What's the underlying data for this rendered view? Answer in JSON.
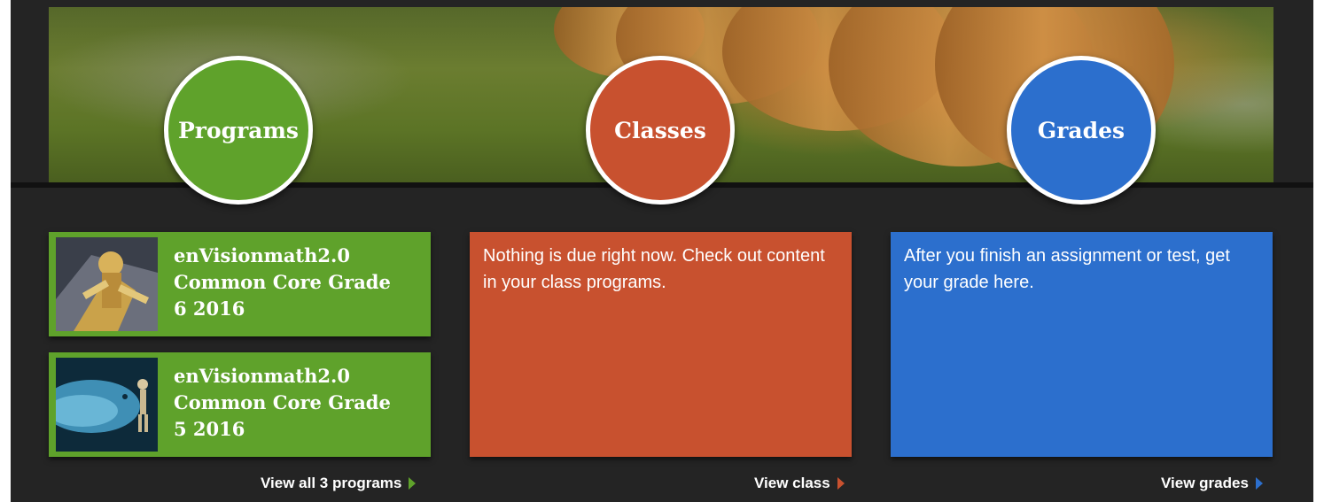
{
  "hero": {
    "circles": [
      {
        "label": "Programs",
        "color": "#5fa22b"
      },
      {
        "label": "Classes",
        "color": "#c8512f"
      },
      {
        "label": "Grades",
        "color": "#2c6fcd"
      }
    ]
  },
  "programs": {
    "items": [
      {
        "title": "enVisionmath2.0 Common Core Grade 6 2016",
        "thumb_icon": "robot-thumbnail-icon"
      },
      {
        "title": "enVisionmath2.0 Common Core Grade 5 2016",
        "thumb_icon": "whale-diver-thumbnail-icon"
      }
    ],
    "link_label": "View all 3 programs"
  },
  "classes": {
    "message": "Nothing is due right now. Check out content in your class programs.",
    "link_label": "View class"
  },
  "grades": {
    "message": "After you finish an assignment or test, get your grade here.",
    "link_label": "View grades"
  },
  "colors": {
    "programs": "#5fa22b",
    "classes": "#c8512f",
    "grades": "#2c6fcd",
    "background": "#242424"
  }
}
